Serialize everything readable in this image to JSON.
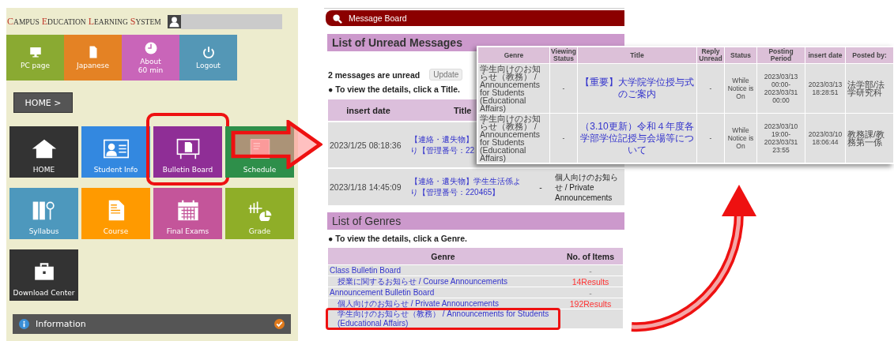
{
  "left_panel": {
    "site_title": "CAMPUS EDUCATION LEARNING SYSTEM",
    "top_buttons": [
      {
        "label": "PC page",
        "color": "#8aaa32"
      },
      {
        "label": "Japanese",
        "color": "#e48224"
      },
      {
        "label": "About\n60 min",
        "color": "#c965b9"
      },
      {
        "label": "Logout",
        "color": "#5497b6"
      }
    ],
    "home_button": "HOME >",
    "tiles": [
      {
        "label": "HOME",
        "color": "#333333",
        "highlighted": false
      },
      {
        "label": "Student Info",
        "color": "#3388e0",
        "highlighted": false
      },
      {
        "label": "Bulletin Board",
        "color": "#8f2e96",
        "highlighted": true
      },
      {
        "label": "Schedule",
        "color": "#2e8f4a",
        "highlighted": false
      },
      {
        "label": "Syllabus",
        "color": "#4d98bd",
        "highlighted": false
      },
      {
        "label": "Course",
        "color": "#ff9a00",
        "highlighted": false
      },
      {
        "label": "Final Exams",
        "color": "#c4559a",
        "highlighted": false
      },
      {
        "label": "Grade",
        "color": "#8fae28",
        "highlighted": false
      },
      {
        "label": "Download Center",
        "color": "#333333",
        "highlighted": false
      }
    ],
    "information": "Information"
  },
  "message_board": {
    "title": "Message Board",
    "unread": {
      "heading": "List of Unread Messages",
      "count_text": "2 messages are unread",
      "update_button": "Update",
      "hint": "● To view the details, click a Title.",
      "columns": [
        "insert date",
        "Title"
      ],
      "rows": [
        {
          "insert_date": "2023/1/25 08:18:36",
          "title_lines": [
            "【連絡・遺失物】",
            "り【管理番号：22"
          ]
        },
        {
          "insert_date": "2023/1/18 14:45:09",
          "title_lines": [
            "【連絡・遺失物】学生生活係よ",
            "り【管理番号：220465】"
          ],
          "reply": "-",
          "genre": "個人向けのお知らせ / Private Announcements"
        }
      ]
    },
    "genres": {
      "heading": "List of Genres",
      "hint": "● To view the details, click a Genre.",
      "columns": [
        "Genre",
        "No. of Items"
      ],
      "rows": [
        {
          "name": "Class Bulletin Board",
          "count": "-",
          "children": [
            {
              "name": "授業に関するお知らせ / Course Announcements",
              "count": "14Results",
              "highlighted": false
            }
          ]
        },
        {
          "name": "Announcement Bulletin Board",
          "count": "-",
          "children": [
            {
              "name": "個人向けのお知らせ / Private Announcements",
              "count": "192Results",
              "highlighted": false
            },
            {
              "name": "学生向けのお知らせ（教務） / Announcements for Students (Educational Affairs)",
              "highlighted": true
            }
          ]
        }
      ]
    }
  },
  "detail_table": {
    "columns": [
      "Genre",
      "Viewing Status",
      "Title",
      "Reply Unread",
      "Status",
      "Posting Period",
      "insert date",
      "Posted by:"
    ],
    "rows": [
      {
        "genre": "学生向けのお知らせ（教務） / Announcements for Students (Educational Affairs)",
        "viewing": "-",
        "title": "【重要】大学院学位授与式のご案内",
        "reply": "-",
        "status": "While Notice is On",
        "period": "2023/03/13 00:00-2023/03/31 00:00",
        "insert_date": "2023/03/13 18:28:51",
        "posted_by": "法学部/法学研究科"
      },
      {
        "genre": "学生向けのお知らせ（教務） / Announcements for Students (Educational Affairs)",
        "viewing": "-",
        "title": "（3.10更新）令和４年度各学部学位記授与会場等について",
        "reply": "-",
        "status": "While Notice is On",
        "period": "2023/03/10 19:00-2023/03/31 23:55",
        "insert_date": "2023/03/10 18:06:44",
        "posted_by": "教務課/教務第一係"
      }
    ]
  }
}
